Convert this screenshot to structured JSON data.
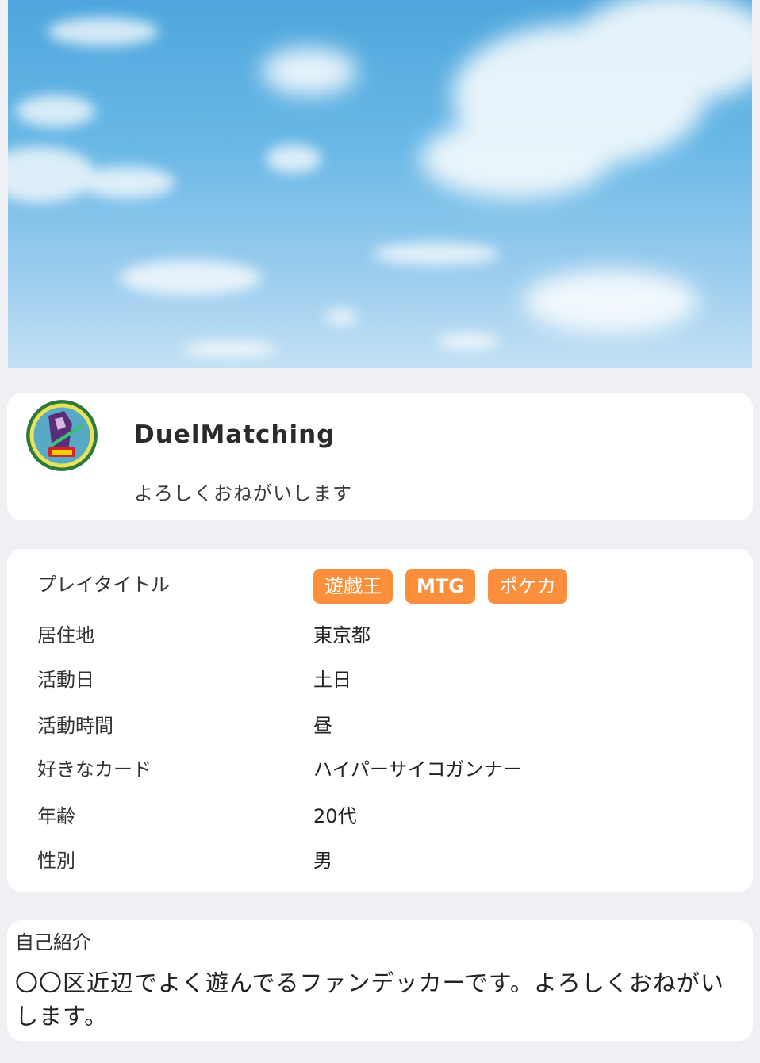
{
  "profile": {
    "username": "DuelMatching",
    "tagline": "よろしくおねがいします"
  },
  "details": {
    "play_title_label": "プレイタイトル",
    "play_titles": [
      "遊戯王",
      "MTG",
      "ポケカ"
    ],
    "residence_label": "居住地",
    "residence_value": "東京都",
    "active_days_label": "活動日",
    "active_days_value": "土日",
    "active_time_label": "活動時間",
    "active_time_value": "昼",
    "favorite_card_label": "好きなカード",
    "favorite_card_value": "ハイパーサイコガンナー",
    "age_label": "年齢",
    "age_value": "20代",
    "gender_label": "性別",
    "gender_value": "男"
  },
  "intro": {
    "heading": "自己紹介",
    "text": "〇〇区近辺でよく遊んでるファンデッカーです。よろしくおねがいします。"
  },
  "colors": {
    "background": "#eef0f4",
    "tag": "#fb8f3c",
    "card": "#ffffff"
  },
  "icons": {
    "avatar": "card-character-avatar",
    "cover": "sky-cover-image"
  }
}
